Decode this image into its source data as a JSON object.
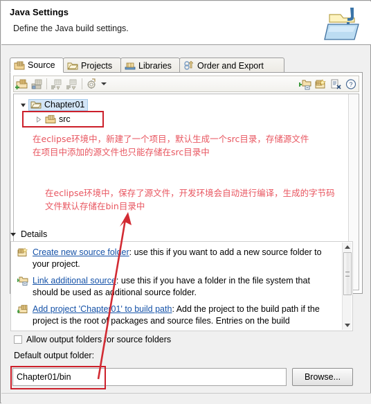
{
  "header": {
    "title": "Java Settings",
    "subtitle": "Define the Java build settings.",
    "icon": "java-build-folder-icon"
  },
  "tabs": [
    {
      "label": "Source",
      "icon": "source-folder-icon",
      "active": true
    },
    {
      "label": "Projects",
      "icon": "projects-folder-icon",
      "active": false
    },
    {
      "label": "Libraries",
      "icon": "libraries-jar-icon",
      "active": false
    },
    {
      "label": "Order and Export",
      "icon": "order-export-icon",
      "active": false
    }
  ],
  "toolbar": {
    "buttons": [
      "add-folder-icon",
      "link-source-icon",
      "edit-filter-icon",
      "remove-filter-icon",
      "configure-icon"
    ],
    "right_buttons": [
      "link-additional-source-icon",
      "create-new-source-folder-icon",
      "remove-source-icon",
      "help-icon"
    ]
  },
  "tree": {
    "project": {
      "label": "Chapter01",
      "icon": "project-folder-icon",
      "selected": true
    },
    "children": [
      {
        "label": "src",
        "icon": "source-folder-icon",
        "expandable": true
      }
    ]
  },
  "annotations": {
    "note1_line1": "在eclipse环境中，新建了一个项目，默认生成一个src目录，存储源文件",
    "note1_line2": "在项目中添加的源文件也只能存储在src目录中",
    "note2_line1": "在eclipse环境中，保存了源文件，开发环境会自动进行编译，生成的字节码",
    "note2_line2": "文件默认存储在bin目录中",
    "color": "#e8555f",
    "box_color": "#cc1f2a",
    "arrow_color": "#d22b33"
  },
  "details": {
    "section_label": "Details",
    "items": [
      {
        "icon": "create-new-source-folder-icon",
        "link": "Create new source folder",
        "text": ": use this if you want to add a new source folder to your project."
      },
      {
        "icon": "link-additional-source-icon",
        "link": "Link additional source",
        "text": ": use this if you have a folder in the file system that should be used as additional source folder."
      },
      {
        "icon": "add-project-build-path-icon",
        "link": "Add project 'Chapter01' to build path",
        "text": ": Add the project to the build path if the project is the root of packages and source files. Entries on the build"
      }
    ]
  },
  "footer": {
    "allow_output_label": "Allow output folders for source folders",
    "allow_output_checked": false,
    "default_output_label": "Default output folder:",
    "default_output_value": "Chapter01/bin",
    "browse_label": "Browse..."
  }
}
